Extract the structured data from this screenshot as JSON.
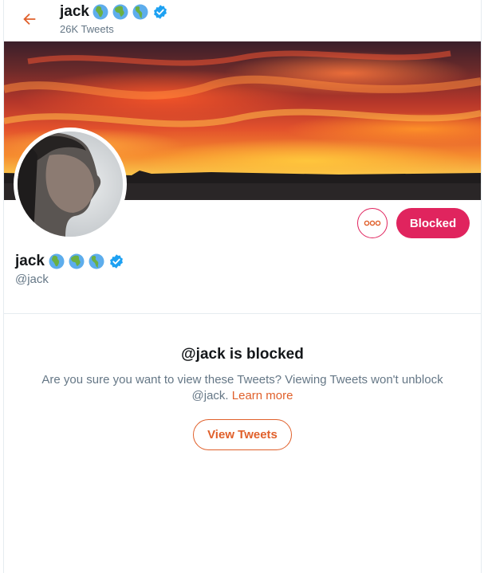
{
  "header": {
    "back_icon": "arrow-left-icon",
    "name": "jack",
    "tweet_count": "26K Tweets",
    "emoji_icons": [
      "globe-africa-icon",
      "globe-europe-icon",
      "globe-americas-icon"
    ],
    "verified_icon": "verified-badge-icon"
  },
  "banner": {
    "description_icon": "sunset-banner-image"
  },
  "profile": {
    "avatar_icon": "profile-photo",
    "name": "jack",
    "handle": "@jack",
    "more_icon": "more-options-icon",
    "blocked_label": "Blocked"
  },
  "blocked_notice": {
    "title": "@jack is blocked",
    "description": "Are you sure you want to view these Tweets? Viewing Tweets won't unblock @jack.",
    "learn_more": "Learn more",
    "view_button": "View Tweets"
  },
  "colors": {
    "accent": "#e0602b",
    "blocked": "#e0245e",
    "verified": "#1da1f2",
    "secondary_text": "#657786"
  }
}
